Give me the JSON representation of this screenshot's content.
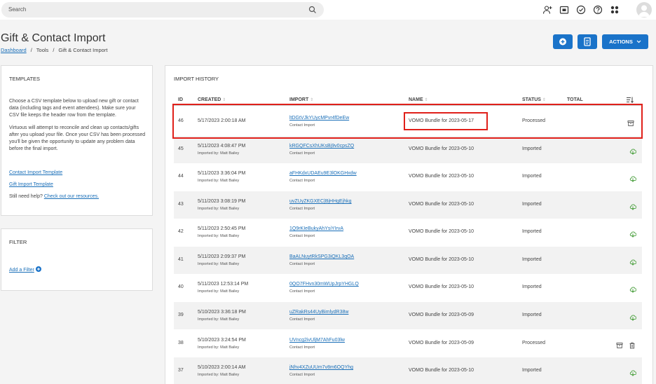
{
  "search": {
    "placeholder": "Search"
  },
  "top_icons": [
    "add-person-icon",
    "folder-icon",
    "check-circle-icon",
    "help-icon",
    "apps-icon",
    "avatar"
  ],
  "header": {
    "title": "Gift & Contact Import",
    "breadcrumb": [
      "Dashboard",
      "Tools",
      "Gift & Contact Import"
    ],
    "actions_label": "ACTIONS"
  },
  "templates": {
    "title": "TEMPLATES",
    "desc1": "Choose a CSV template below to upload new gift or contact data (including tags and event attendees). Make sure your CSV file keeps the header row from the template.",
    "desc2": "Virtuous will attempt to reconcile and clean up contacts/gifts after you upload your file. Once your CSV has been processed you'll be given the opportunity to update any problem data before the final import.",
    "link1": "Contact Import Template",
    "link2": "Gift Import Template",
    "help_prefix": "Still need help? ",
    "help_link": "Check out our resources."
  },
  "filter": {
    "title": "FILTER",
    "add_label": "Add a Filter"
  },
  "history": {
    "title": "IMPORT HISTORY",
    "columns": {
      "id": "ID",
      "created": "CREATED",
      "import": "IMPORT",
      "name": "NAME",
      "status": "STATUS",
      "total": "TOTAL"
    },
    "rows": [
      {
        "id": "46",
        "created": "5/17/2023 2:00:18 AM",
        "by": "",
        "import": "ltDGtVJkYUycMPvr4fDeEw",
        "type": "Contact Import",
        "name": "VOMO Bundle for 2023-05-17",
        "status": "Processed"
      },
      {
        "id": "45",
        "created": "5/11/2023 4:08:47 PM",
        "by": "Imported by: Matt Bailey",
        "import": "kRGQFCsXhUKsBj9v0cpsZQ",
        "type": "Contact Import",
        "name": "VOMO Bundle for 2023-05-10",
        "status": "Imported"
      },
      {
        "id": "44",
        "created": "5/11/2023 3:36:04 PM",
        "by": "Imported by: Matt Bailey",
        "import": "aFHKdxUDAEu9E3lOKGHxdw",
        "type": "Contact Import",
        "name": "VOMO Bundle for 2023-05-10",
        "status": "Imported"
      },
      {
        "id": "43",
        "created": "5/11/2023 3:08:19 PM",
        "by": "Imported by: Matt Bailey",
        "import": "uvZUyZKGXEC|BjHHgEjhkg",
        "type": "Contact Import",
        "name": "VOMO Bundle for 2023-05-10",
        "status": "Imported"
      },
      {
        "id": "42",
        "created": "5/11/2023 2:50:45 PM",
        "by": "Imported by: Matt Bailey",
        "import": "1Q9rKIeBukyAhYsiYIrvA",
        "type": "Contact Import",
        "name": "VOMO Bundle for 2023-05-10",
        "status": "Imported"
      },
      {
        "id": "41",
        "created": "5/11/2023 2:09:37 PM",
        "by": "Imported by: Matt Bailey",
        "import": "BaALNuytRkSPG3iQKL3qOA",
        "type": "Contact Import",
        "name": "VOMO Bundle for 2023-05-10",
        "status": "Imported"
      },
      {
        "id": "40",
        "created": "5/11/2023 12:53:14 PM",
        "by": "Imported by: Matt Bailey",
        "import": "0QO7FHvn30mWUpJrpYHGLQ",
        "type": "Contact Import",
        "name": "VOMO Bundle for 2023-05-10",
        "status": "Imported"
      },
      {
        "id": "39",
        "created": "5/10/2023 3:36:18 PM",
        "by": "Imported by: Matt Bailey",
        "import": "uZRakRs44UyBimlydR38w",
        "type": "Contact Import",
        "name": "VOMO Bundle for 2023-05-09",
        "status": "Imported"
      },
      {
        "id": "38",
        "created": "5/10/2023 3:24:54 PM",
        "by": "Imported by: Matt Bailey",
        "import": "UVncg2ivUljM7AhFu03lw",
        "type": "Contact Import",
        "name": "VOMO Bundle for 2023-05-09",
        "status": "Processed"
      },
      {
        "id": "37",
        "created": "5/10/2023 2:00:14 AM",
        "by": "Imported by: Matt Bailey",
        "import": "jNhv4XZuUUm7v8m6OQYhg",
        "type": "Contact Import",
        "name": "VOMO Bundle for 2023-05-10",
        "status": "Imported"
      }
    ]
  },
  "colors": {
    "accent": "#1a73c9",
    "link": "#1a6fb8",
    "highlight": "#e0201a",
    "cloud_green": "#5aa84f"
  }
}
